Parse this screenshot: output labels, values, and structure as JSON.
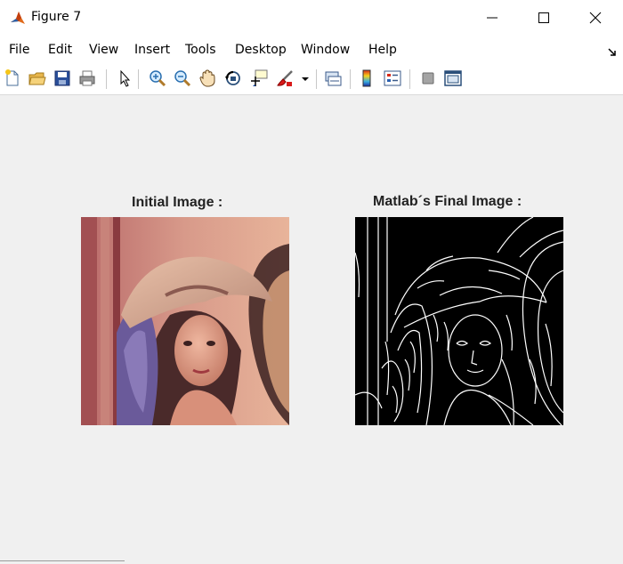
{
  "window": {
    "title": "Figure 7"
  },
  "menu": [
    "File",
    "Edit",
    "View",
    "Insert",
    "Tools",
    "Desktop",
    "Window",
    "Help"
  ],
  "toolbar": [
    "new-figure-icon",
    "open-file-icon",
    "save-icon",
    "print-icon",
    "edit-plot-arrow-icon",
    "zoom-in-icon",
    "zoom-out-icon",
    "pan-hand-icon",
    "rotate-3d-icon",
    "data-cursor-icon",
    "brush-icon",
    "brush-dropdown-icon",
    "link-plot-icon",
    "insert-colorbar-icon",
    "insert-legend-icon",
    "hide-plot-tools-icon",
    "show-plot-tools-icon"
  ],
  "axes": [
    {
      "title": "Initial Image :"
    },
    {
      "title": "Matlab´s Final Image :"
    }
  ]
}
